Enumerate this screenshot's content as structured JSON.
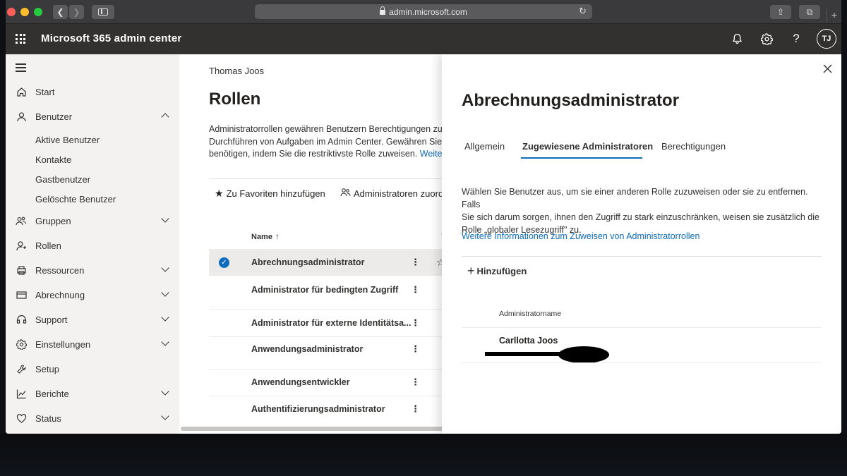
{
  "browser": {
    "url": "admin.microsoft.com"
  },
  "header": {
    "app_title": "Microsoft 365 admin center",
    "avatar_initials": "TJ"
  },
  "leftnav": {
    "items": [
      {
        "label": "Start",
        "icon": "home-icon"
      },
      {
        "label": "Benutzer",
        "icon": "person-icon",
        "expanded": true
      },
      {
        "label": "Gruppen",
        "icon": "groups-icon"
      },
      {
        "label": "Rollen",
        "icon": "roles-icon"
      },
      {
        "label": "Ressourcen",
        "icon": "printer-icon"
      },
      {
        "label": "Abrechnung",
        "icon": "credit-card-icon"
      },
      {
        "label": "Support",
        "icon": "headset-icon"
      },
      {
        "label": "Einstellungen",
        "icon": "gear-icon"
      },
      {
        "label": "Setup",
        "icon": "wrench-icon"
      },
      {
        "label": "Berichte",
        "icon": "chart-icon"
      },
      {
        "label": "Status",
        "icon": "heart-icon"
      }
    ],
    "benutzer_sub": [
      "Aktive Benutzer",
      "Kontakte",
      "Gastbenutzer",
      "Gelöschte Benutzer"
    ]
  },
  "main": {
    "tenant": "Thomas Joos",
    "title": "Rollen",
    "desc_line1": "Administratorrollen gewähren Benutzern Berechtigungen zum",
    "desc_line2": "Durchführen von Aufgaben im Admin Center. Gewähren Sie B",
    "desc_line3": "benötigen, indem Sie die restriktivste Rolle zuweisen.",
    "desc_link": "Weitere",
    "cmd_favorites": "Zu Favoriten hinzufügen",
    "cmd_assign": "Administratoren zuordn",
    "col_name": "Name",
    "roles": [
      "Abrechnungsadministrator",
      "Administrator für bedingten Zugriff",
      "Administrator für externe Identitätsa...",
      "Anwendungsadministrator",
      "Anwendungsentwickler",
      "Authentifizierungsadministrator"
    ]
  },
  "panel": {
    "title": "Abrechnungsadministrator",
    "tabs": [
      "Allgemein",
      "Zugewiesene Administratoren",
      "Berechtigungen"
    ],
    "active_tab": "Zugewiesene Administratoren",
    "desc_line1": "Wählen Sie Benutzer aus, um sie einer anderen Rolle zuzuweisen oder sie zu entfernen. Falls",
    "desc_line2": "Sie sich darum sorgen, ihnen den Zugriff zu stark einzuschränken, weisen sie zusätzlich die",
    "desc_line3": "Rolle „globaler Lesezugriff\" zu.",
    "link": "Weitere Informationen zum Zuweisen von Administratorrollen",
    "add_label": "Hinzufügen",
    "col_admin_name": "Administratorname",
    "admins": [
      {
        "name": "Carllotta Joos"
      }
    ]
  },
  "colors": {
    "header_bg": "#323130",
    "accent": "#0f6cbd",
    "nav_bg": "#f3f2f1"
  }
}
